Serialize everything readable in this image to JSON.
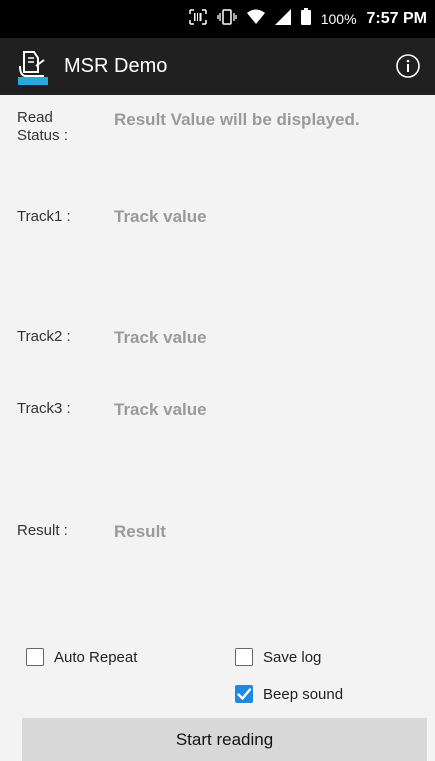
{
  "status_bar": {
    "battery_percent": "100%",
    "time": "7:57 PM"
  },
  "app_bar": {
    "title": "MSR Demo",
    "logo_icon": "card-swipe-icon",
    "info_icon": "info-icon"
  },
  "fields": {
    "read_status": {
      "label": "Read\nStatus :",
      "value": "Result Value will be displayed."
    },
    "track1": {
      "label": "Track1 :",
      "value": "Track value"
    },
    "track2": {
      "label": "Track2 :",
      "value": "Track value"
    },
    "track3": {
      "label": "Track3 :",
      "value": "Track value"
    },
    "result": {
      "label": "Result :",
      "value": "Result"
    }
  },
  "options": {
    "auto_repeat": {
      "label": "Auto Repeat",
      "checked": false
    },
    "save_log": {
      "label": "Save log",
      "checked": false
    },
    "beep_sound": {
      "label": "Beep sound",
      "checked": true
    }
  },
  "actions": {
    "start_label": "Start reading"
  },
  "colors": {
    "app_bar": "#202020",
    "background": "#f3f3f3",
    "accent": "#1e88e5",
    "value_text": "#9a9a9a"
  }
}
